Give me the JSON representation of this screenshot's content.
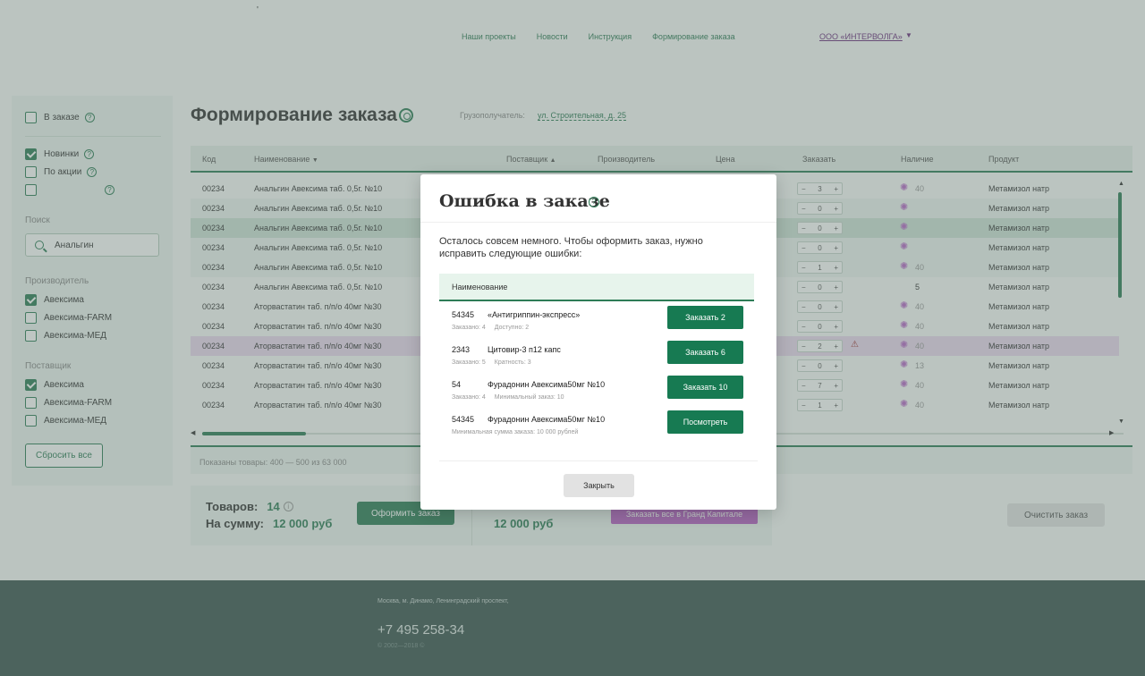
{
  "nav": {
    "items": [
      "Наши проекты",
      "Новости",
      "Инструкция",
      "Формирование заказа"
    ],
    "company": "ООО «ИНТЕРВОЛГА»",
    "tick": "'"
  },
  "sidebar": {
    "in_order": "В заказе",
    "new_items": "Новинки",
    "on_sale": "По акции",
    "search_label": "Поиск",
    "search_value": "Анальгин",
    "manufacturer_label": "Производитель",
    "manufacturers": [
      "Авексима",
      "Авексима-FARM",
      "Авексима-МЕД"
    ],
    "supplier_label": "Поставщик",
    "suppliers": [
      "Авексима",
      "Авексима-FARM",
      "Авексима-МЕД"
    ],
    "reset": "Сбросить все"
  },
  "page": {
    "title": "Формирование заказа",
    "consignee_label": "Грузополучатель:",
    "consignee_value": "ул. Строительная, д. 25"
  },
  "table": {
    "headers": [
      "Код",
      "Наименование",
      "Поставщик",
      "Производитель",
      "Цена",
      "Заказать",
      "Наличие",
      "Продукт"
    ],
    "sort_down": "▼",
    "sort_up": "▲",
    "rows": [
      {
        "code": "00234",
        "name": "Анальгин Авексима таб. 0,5г. №10",
        "qty": "3",
        "avail": "40",
        "product": "Метамизол натр"
      },
      {
        "code": "00234",
        "name": "Анальгин Авексима таб. 0,5г. №10",
        "qty": "0",
        "avail": "",
        "product": "Метамизол натр"
      },
      {
        "code": "00234",
        "name": "Анальгин Авексима таб. 0,5г. №10",
        "qty": "0",
        "avail": "",
        "product": "Метамизол натр"
      },
      {
        "code": "00234",
        "name": "Анальгин Авексима таб. 0,5г. №10",
        "qty": "0",
        "avail": "",
        "product": "Метамизол натр"
      },
      {
        "code": "00234",
        "name": "Анальгин Авексима таб. 0,5г. №10",
        "qty": "1",
        "avail": "40",
        "product": "Метамизол натр"
      },
      {
        "code": "00234",
        "name": "Анальгин Авексима таб. 0,5г. №10",
        "qty": "0",
        "avail": "5",
        "product": "Метамизол натр"
      },
      {
        "code": "00234",
        "name": "Аторвастатин таб. п/п/о 40мг №30",
        "qty": "0",
        "avail": "40",
        "product": "Метамизол натр"
      },
      {
        "code": "00234",
        "name": "Аторвастатин таб. п/п/о 40мг №30",
        "qty": "0",
        "avail": "40",
        "product": "Метамизол натр"
      },
      {
        "code": "00234",
        "name": "Аторвастатин таб. п/п/о 40мг №30",
        "qty": "2",
        "avail": "40",
        "product": "Метамизол натр"
      },
      {
        "code": "00234",
        "name": "Аторвастатин таб. п/п/о 40мг №30",
        "qty": "0",
        "avail": "13",
        "product": "Метамизол натр"
      },
      {
        "code": "00234",
        "name": "Аторвастатин таб. п/п/о 40мг №30",
        "qty": "7",
        "avail": "40",
        "product": "Метамизол натр"
      },
      {
        "code": "00234",
        "name": "Аторвастатин таб. п/п/о 40мг №30",
        "qty": "1",
        "avail": "40",
        "product": "Метамизол натр"
      }
    ],
    "footer": "Показаны товары: 400 — 500 из 63 000"
  },
  "summary": {
    "goods_label": "Товаров:",
    "goods_value": "14",
    "sum_label": "На сумму:",
    "sum_value": "12 000 руб",
    "checkout": "Оформить заказ",
    "sum2_value": "12 000 руб",
    "grand": "Заказать все в Гранд Капитале",
    "clear": "Очистить заказ"
  },
  "footer": {
    "address": "Москва, м. Динамо, Ленинградский проспект,",
    "phone": "+7 495 258-34",
    "copyright": "© 2002—2018 ©"
  },
  "modal": {
    "title": "Ошибка в заказе",
    "message": "Осталось совсем немного. Чтобы оформить заказ, нужно исправить следующие ошибки:",
    "column": "Наименование",
    "items": [
      {
        "code": "54345",
        "name": "«Антигриппин-экспресс»",
        "sub1": "Заказано: 4",
        "sub2": "Доступно: 2",
        "button": "Заказать 2"
      },
      {
        "code": "2343",
        "name": "Цитовир-3 п12 капс",
        "sub1": "Заказано: 5",
        "sub2": "Кратность: 3",
        "button": "Заказать 6"
      },
      {
        "code": "54",
        "name": "Фурадонин Авексима50мг №10",
        "sub1": "Заказано: 4",
        "sub2": "Минимальный заказ: 10",
        "button": "Заказать 10"
      },
      {
        "code": "54345",
        "name": "Фурадонин Авексима50мг №10",
        "sub1": "Минимальная сумма заказа: 10 000 рублей",
        "sub2": "",
        "button": "Посмотреть"
      }
    ],
    "close": "Закрыть"
  },
  "colors": {
    "accent": "#2e7c57",
    "purple": "#b85fc4",
    "overlay": "#647870"
  }
}
